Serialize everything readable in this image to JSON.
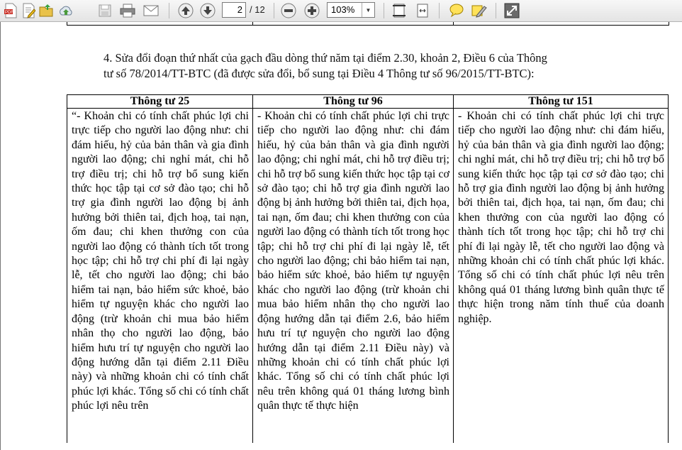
{
  "toolbar": {
    "icons": [
      "pdf-file-icon",
      "edit-document-icon",
      "open-folder-icon",
      "upload-cloud-icon",
      "save-disk-icon",
      "print-icon",
      "email-icon",
      "page-up-icon",
      "page-down-icon",
      "zoom-out-icon",
      "zoom-in-icon",
      "fit-page-icon",
      "fit-width-icon",
      "comment-icon",
      "highlight-icon",
      "fullscreen-icon"
    ],
    "current_page": "2",
    "total_pages": "/ 12",
    "zoom": "103%"
  },
  "document": {
    "intro_line1": "4. Sửa đổi đoạn thứ nhất của gạch đầu dòng thứ năm tại điểm 2.30, khoản 2, Điều 6 của Thông",
    "intro_line2": "tư số 78/2014/TT-BTC (đã được sửa đổi, bổ sung tại Điều 4 Thông tư số 96/2015/TT-BTC):",
    "table": {
      "headers": [
        "Thông tư 25",
        "Thông tư 96",
        "Thông tư 151"
      ],
      "col1": "“- Khoản chi có tính chất phúc lợi chi trực tiếp cho người lao động như: chi đám hiếu, hỷ của bản thân và gia đình người lao động; chi nghỉ mát, chi hỗ trợ điều trị; chi hỗ trợ bổ sung kiến thức học tập tại cơ sở đào tạo; chi hỗ trợ gia đình người lao động bị ảnh hưởng bởi thiên tai, địch hoạ, tai nạn, ốm đau; chi khen thưởng con của người lao động có thành tích tốt trong học tập; chi hỗ trợ chi phí đi lại ngày lễ, tết cho người lao động; chi bảo hiểm tai nạn, bảo hiểm sức khoẻ, bảo hiểm tự nguyện khác cho người lao động (trừ khoản chi mua bảo hiểm nhân thọ cho người lao động, bảo hiểm hưu trí tự nguyện cho người lao động hướng dẫn tại điểm 2.11 Điều này) và những khoản chi có tính chất phúc lợi khác. Tổng số chi có tính chất phúc lợi nêu trên",
      "col2": "- Khoản chi có tính chất phúc lợi chi trực tiếp cho người lao động như: chi đám hiếu, hỷ của bản thân và gia đình người lao động; chi nghỉ mát, chi hỗ trợ điều trị; chi hỗ trợ bổ sung kiến thức học tập tại cơ sở đào tạo; chi hỗ trợ gia đình người lao động bị ảnh hưởng bởi thiên tai, địch họa, tai nạn, ốm đau; chi khen thưởng con của người lao động có thành tích tốt trong học tập; chi hỗ trợ chi phí đi lại ngày lễ, tết cho người lao động; chi bảo hiểm tai nạn, bảo hiểm sức khoẻ, bảo hiểm tự nguyện khác cho người lao động (trừ khoản chi mua bảo hiểm nhân thọ cho người lao động hướng dẫn tại điểm 2.6, bảo hiểm hưu trí tự nguyện cho người lao động hướng dẫn tại điểm 2.11 Điều này) và những khoản chi có tính chất phúc lợi khác. Tổng số chi có tính chất phúc lợi nêu trên không quá 01 tháng lương bình quân thực tế thực hiện",
      "col3": "- Khoản chi có tính chất phúc lợi chi trực tiếp cho người lao động như: chi đám hiếu, hỷ của bản thân và gia đình người lao động; chi nghỉ mát, chi hỗ trợ điều trị; chi hỗ trợ bổ sung kiến thức học tập tại cơ sở đào tạo; chi hỗ trợ gia đình người lao động bị ảnh hưởng bởi thiên tai, địch họa, tai nạn, ốm đau; chi khen thưởng con của người lao động có thành tích tốt trong học tập; chi hỗ trợ chi phí đi lại ngày lễ, tết cho người lao động và những khoản chi có tính chất phúc lợi khác. Tổng số chi có tính chất phúc lợi nêu trên không quá 01 tháng lương bình quân thực tế thực hiện trong năm tính thuế của doanh nghiệp."
    }
  }
}
